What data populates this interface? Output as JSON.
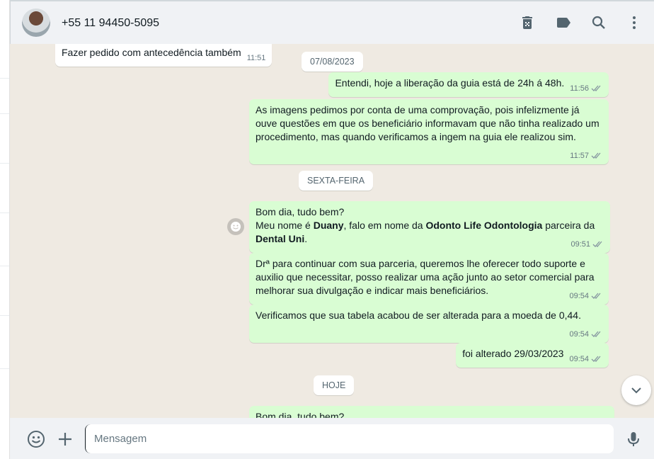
{
  "header": {
    "contact": "+55 11 94450-5095",
    "icons": [
      "delete-icon",
      "label-icon",
      "search-icon",
      "menu-icon"
    ]
  },
  "messages": [
    {
      "dir": "in",
      "text": "Fazer pedido com antecedência também",
      "time": "11:51"
    },
    {
      "type": "date",
      "text": "07/08/2023"
    },
    {
      "dir": "out",
      "text": "Entendi, hoje a liberação da guia está de 24h á 48h.",
      "time": "11:56"
    },
    {
      "dir": "out",
      "text": "As imagens pedimos por conta de uma comprovação, pois infelizmente já ouve questões em que os beneficiário informavam que não tinha realizado um procedimento, mas quando verificamos a ingem na guia ele realizou sim.",
      "time": "11:57"
    },
    {
      "type": "date",
      "text": "SEXTA-FEIRA"
    },
    {
      "dir": "out",
      "line1": "Bom dia, tudo bem?",
      "p1": "Meu nome é ",
      "b1": "Duany",
      "p2": ", falo em nome da ",
      "b2": "Odonto Life Odontologia",
      "p3": " parceira da ",
      "b3": "Dental Uni",
      "p4": ".",
      "time": "09:51"
    },
    {
      "dir": "out",
      "text": "Drª para continuar com sua parceria, queremos lhe oferecer todo suporte e auxilio que necessitar, posso realizar uma ação junto ao setor comercial para melhorar sua divulgação e indicar mais beneficiários.",
      "time": "09:54"
    },
    {
      "dir": "out",
      "text": "Verificamos que sua tabela acabou de ser alterada para a moeda de 0,44.",
      "time": "09:54"
    },
    {
      "dir": "out",
      "text": "foi alterado 29/03/2023",
      "time": "09:54"
    },
    {
      "type": "date",
      "text": "HOJE"
    },
    {
      "dir": "out",
      "text": "Bom dia, tudo bem?"
    }
  ],
  "footer": {
    "placeholder": "Mensagem"
  }
}
